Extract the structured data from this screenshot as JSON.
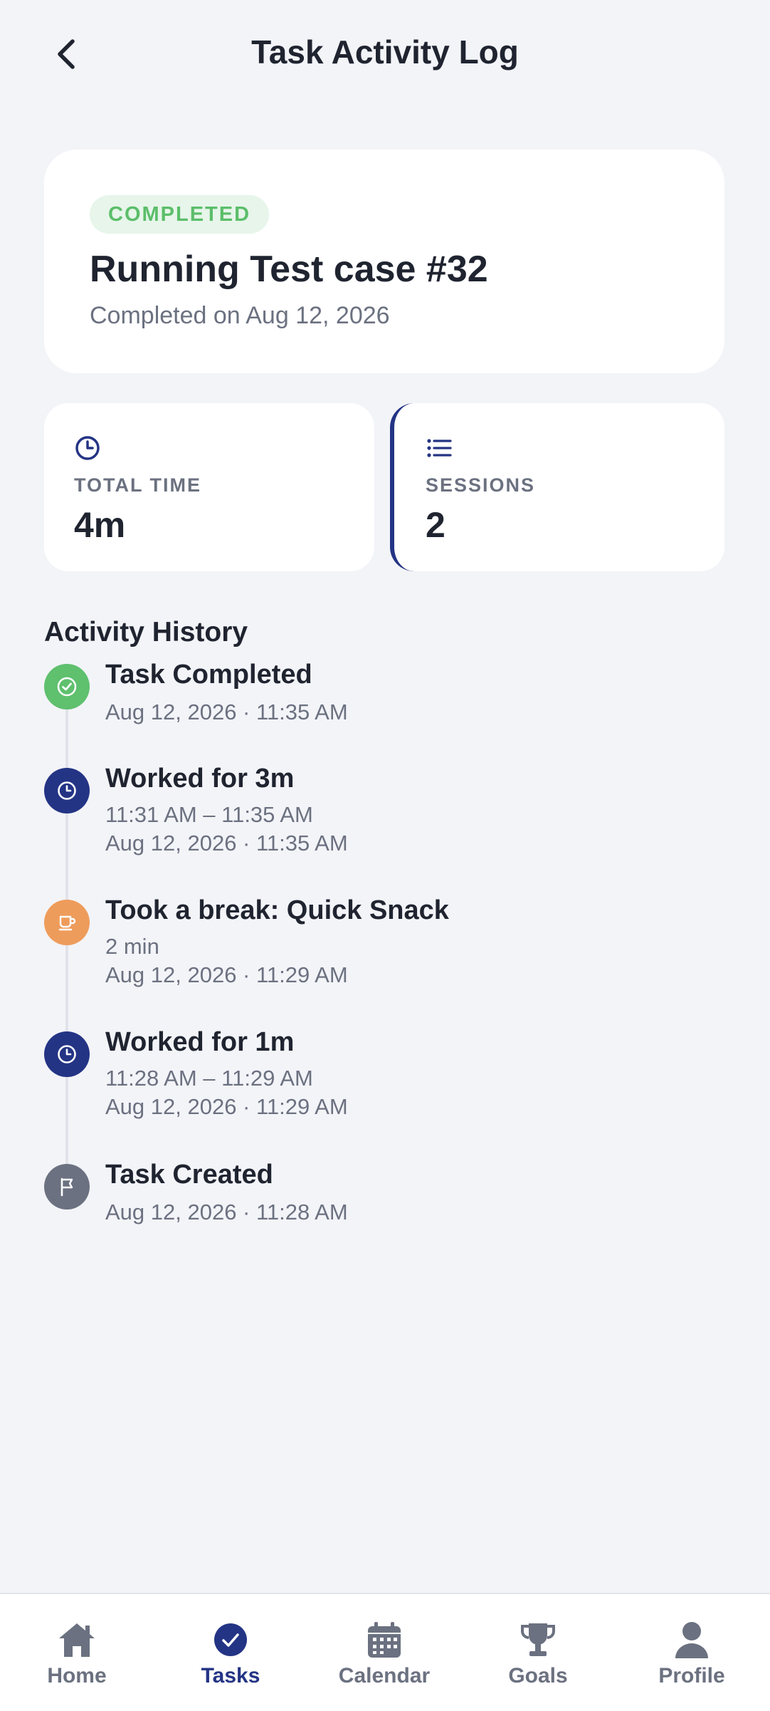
{
  "header": {
    "title": "Task Activity Log",
    "back_icon": "chevron-left-icon"
  },
  "summary": {
    "status": "COMPLETED",
    "title": "Running Test case #32",
    "subtitle": "Completed on Aug 12, 2026"
  },
  "stats": [
    {
      "icon": "clock-icon",
      "label": "TOTAL TIME",
      "value": "4m"
    },
    {
      "icon": "list-icon",
      "label": "SESSIONS",
      "value": "2"
    }
  ],
  "activity": {
    "title": "Activity History",
    "events": [
      {
        "icon": "check-circle-icon",
        "color": "#5FC06E",
        "title": "Task Completed",
        "lines": [
          "Aug 12, 2026 · 11:35 AM"
        ]
      },
      {
        "icon": "clock-icon",
        "color": "#243485",
        "title": "Worked for 3m",
        "lines": [
          "11:31 AM – 11:35 AM",
          "Aug 12, 2026 · 11:35 AM"
        ]
      },
      {
        "icon": "coffee-icon",
        "color": "#EE9C5C",
        "title": "Took a break: Quick Snack",
        "lines": [
          "2 min",
          "Aug 12, 2026 · 11:29 AM"
        ]
      },
      {
        "icon": "clock-icon",
        "color": "#243485",
        "title": "Worked for 1m",
        "lines": [
          "11:28 AM – 11:29 AM",
          "Aug 12, 2026 · 11:29 AM"
        ]
      },
      {
        "icon": "flag-icon",
        "color": "#6B7180",
        "title": "Task Created",
        "lines": [
          "Aug 12, 2026 · 11:28 AM"
        ]
      }
    ]
  },
  "nav": {
    "active": "Tasks",
    "items": [
      {
        "label": "Home",
        "icon": "home-icon"
      },
      {
        "label": "Tasks",
        "icon": "check-circle-icon"
      },
      {
        "label": "Calendar",
        "icon": "calendar-icon"
      },
      {
        "label": "Goals",
        "icon": "trophy-icon"
      },
      {
        "label": "Profile",
        "icon": "person-icon"
      }
    ]
  },
  "colors": {
    "accent": "#243485",
    "success": "#5FC06E",
    "break": "#EE9C5C",
    "muted": "#6B7180",
    "background": "#F3F4F8"
  }
}
